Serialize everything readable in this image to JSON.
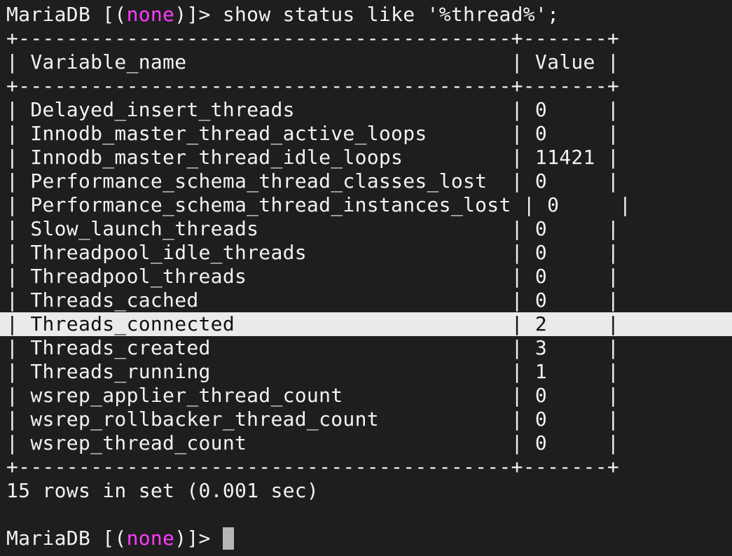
{
  "colors": {
    "background": "#1e1e1e",
    "text": "#f2f2f2",
    "prompt_database": "#ff3cff",
    "highlight_row_background": "#eaeaea",
    "cursor": "#b7b7b7"
  },
  "prompt": {
    "prefix": "MariaDB [(",
    "database": "none",
    "suffix": ")]> "
  },
  "command": "show status like '%thread%';",
  "table": {
    "border": "+-----------------------------------------+-------+",
    "header": "| Variable_name                           | Value |",
    "rows": [
      "| Delayed_insert_threads                  | 0     |",
      "| Innodb_master_thread_active_loops       | 0     |",
      "| Innodb_master_thread_idle_loops         | 11421 |",
      "| Performance_schema_thread_classes_lost  | 0     |",
      "| Performance_schema_thread_instances_lost | 0     |",
      "| Slow_launch_threads                     | 0     |",
      "| Threadpool_idle_threads                 | 0     |",
      "| Threadpool_threads                      | 0     |",
      "| Threads_cached                          | 0     |",
      "| Threads_connected                       | 2     |",
      "| Threads_created                         | 3     |",
      "| Threads_running                         | 1     |",
      "| wsrep_applier_thread_count              | 0     |",
      "| wsrep_rollbacker_thread_count           | 0     |",
      "| wsrep_thread_count                      | 0     |"
    ],
    "highlighted_row_index": 9
  },
  "result_summary": "15 rows in set (0.001 sec)"
}
